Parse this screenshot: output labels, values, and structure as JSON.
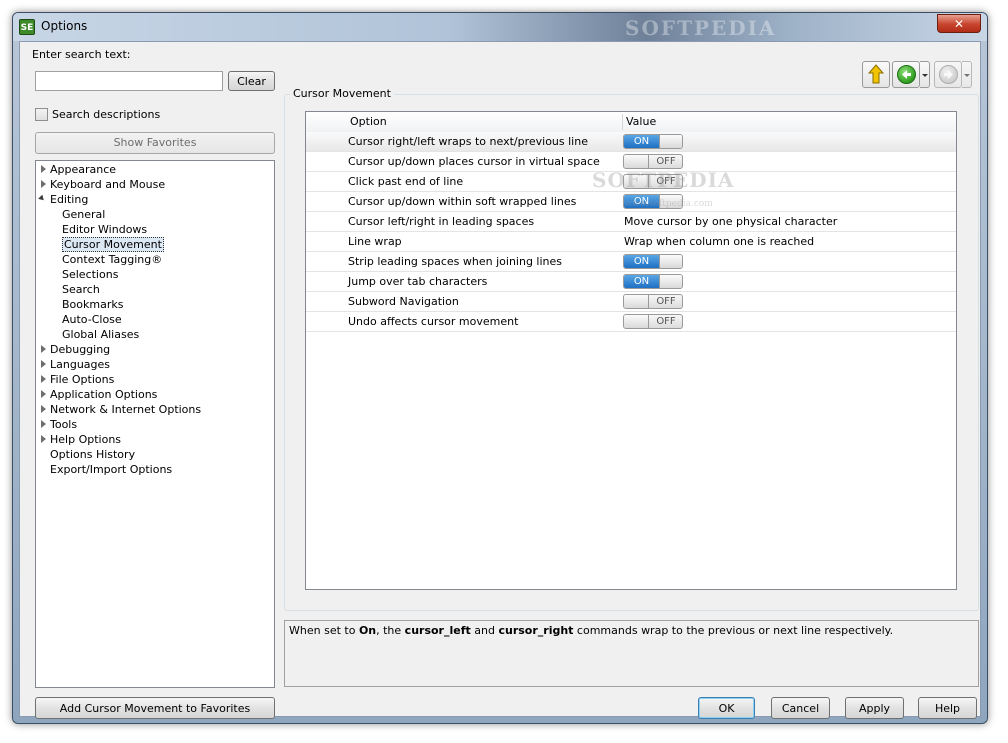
{
  "window": {
    "title": "Options",
    "icon_text": "SE",
    "title_watermark": "SOFTPEDIA",
    "close_glyph": "✕"
  },
  "search": {
    "label": "Enter search text:",
    "value": "",
    "clear_label": "Clear",
    "descriptions_label": "Search descriptions",
    "descriptions_checked": false,
    "favorites_label": "Show Favorites"
  },
  "tree": [
    {
      "label": "Appearance",
      "level": 0,
      "expander": "closed"
    },
    {
      "label": "Keyboard and Mouse",
      "level": 0,
      "expander": "closed"
    },
    {
      "label": "Editing",
      "level": 0,
      "expander": "open"
    },
    {
      "label": "General",
      "level": 1,
      "expander": "none"
    },
    {
      "label": "Editor Windows",
      "level": 1,
      "expander": "none"
    },
    {
      "label": "Cursor Movement",
      "level": 1,
      "expander": "none",
      "selected": true
    },
    {
      "label": "Context Tagging®",
      "level": 1,
      "expander": "none"
    },
    {
      "label": "Selections",
      "level": 1,
      "expander": "none"
    },
    {
      "label": "Search",
      "level": 1,
      "expander": "none"
    },
    {
      "label": "Bookmarks",
      "level": 1,
      "expander": "none"
    },
    {
      "label": "Auto-Close",
      "level": 1,
      "expander": "none"
    },
    {
      "label": "Global Aliases",
      "level": 1,
      "expander": "none"
    },
    {
      "label": "Debugging",
      "level": 0,
      "expander": "closed"
    },
    {
      "label": "Languages",
      "level": 0,
      "expander": "closed"
    },
    {
      "label": "File Options",
      "level": 0,
      "expander": "closed"
    },
    {
      "label": "Application Options",
      "level": 0,
      "expander": "closed"
    },
    {
      "label": "Network & Internet Options",
      "level": 0,
      "expander": "closed"
    },
    {
      "label": "Tools",
      "level": 0,
      "expander": "closed"
    },
    {
      "label": "Help Options",
      "level": 0,
      "expander": "closed"
    },
    {
      "label": "Options History",
      "level": 0,
      "expander": "none"
    },
    {
      "label": "Export/Import Options",
      "level": 0,
      "expander": "none"
    }
  ],
  "section": {
    "title": "Cursor Movement",
    "columns": [
      "Option",
      "Value"
    ],
    "rows": [
      {
        "option": "Cursor right/left wraps to next/previous line",
        "type": "toggle",
        "state": "ON",
        "highlighted": true
      },
      {
        "option": "Cursor up/down places cursor in virtual space",
        "type": "toggle",
        "state": "OFF"
      },
      {
        "option": "Click past end of line",
        "type": "toggle",
        "state": "OFF"
      },
      {
        "option": "Cursor up/down within soft wrapped lines",
        "type": "toggle",
        "state": "ON"
      },
      {
        "option": "Cursor left/right in leading spaces",
        "type": "text",
        "value": "Move cursor by one physical character"
      },
      {
        "option": "Line wrap",
        "type": "text",
        "value": "Wrap when column one is reached"
      },
      {
        "option": "Strip leading spaces when joining lines",
        "type": "toggle",
        "state": "ON"
      },
      {
        "option": "Jump over tab characters",
        "type": "toggle",
        "state": "ON"
      },
      {
        "option": "Subword Navigation",
        "type": "toggle",
        "state": "OFF"
      },
      {
        "option": "Undo affects cursor movement",
        "type": "toggle",
        "state": "OFF"
      }
    ],
    "watermark": "SOFTPEDIA",
    "watermark_url": "www.softpedia.com"
  },
  "description": {
    "t1": "When set to ",
    "b1": "On",
    "t2": ", the ",
    "b2": "cursor_left",
    "t3": " and ",
    "b3": "cursor_right",
    "t4": " commands wrap to the previous or next line respectively."
  },
  "buttons": {
    "add_favorites": "Add Cursor Movement to Favorites",
    "ok": "OK",
    "cancel": "Cancel",
    "apply": "Apply",
    "help": "Help"
  },
  "colors": {
    "toggle_on": "#1f6fc2",
    "up_arrow": "#f2c400",
    "back_arrow": "#2f9e1f"
  }
}
